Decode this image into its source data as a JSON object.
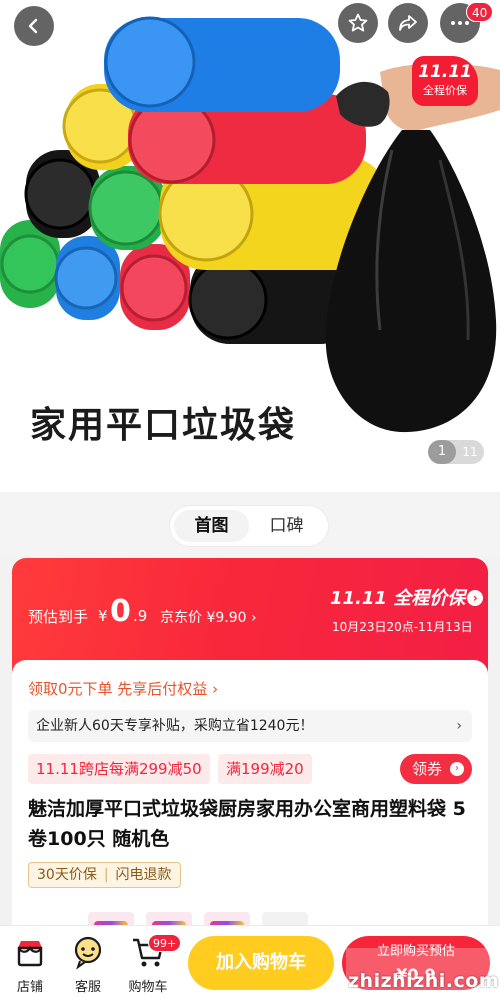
{
  "header": {
    "cart_count": "40"
  },
  "hero": {
    "caption": "家用平口垃圾袋",
    "sticker_line1": "11.11",
    "sticker_line2": "全程价保",
    "image_index": "1",
    "image_total": "11"
  },
  "tabs": [
    {
      "label": "首图",
      "active": true
    },
    {
      "label": "口碑",
      "active": false
    }
  ],
  "price": {
    "prefix": "预估到手",
    "currency": "¥",
    "integer": "0",
    "decimal": ".9",
    "jd_price": "京东价 ¥9.90 ›",
    "promo_title": "11.11 全程价保",
    "promo_dates": "10月23日20点-11月13日"
  },
  "info": {
    "credit_line": "领取0元下单 先享后付权益 ›",
    "subsidy": "企业新人60天专享补贴，采购立省1240元！",
    "subsidy_chevron": "›",
    "coupons": [
      "11.11跨店每满299减50",
      "满199减20"
    ],
    "claim_label": "领券",
    "title": "魅洁加厚平口式垃圾袋厨房家用办公室商用塑料袋 5卷100只 随机色",
    "guarantees": [
      "30天价保",
      "闪电退款"
    ]
  },
  "bottom": {
    "store_label": "店铺",
    "service_label": "客服",
    "cart_label": "购物车",
    "cart_badge": "99+",
    "add_to_cart": "加入购物车",
    "buy_now_line1": "立即购买预估",
    "buy_now_line2": "¥0.9",
    "watermark": "zhizhizhi.com"
  },
  "colors": {
    "brand_red": "#f5263a",
    "cart_yellow": "#ffcc1f",
    "coupon_bg": "#fdeaea",
    "guarantee_bg": "#fdf4e3"
  },
  "icons": [
    "back-arrow-icon",
    "star-icon",
    "share-icon",
    "more-icon",
    "store-icon",
    "customer-service-icon",
    "cart-icon"
  ]
}
